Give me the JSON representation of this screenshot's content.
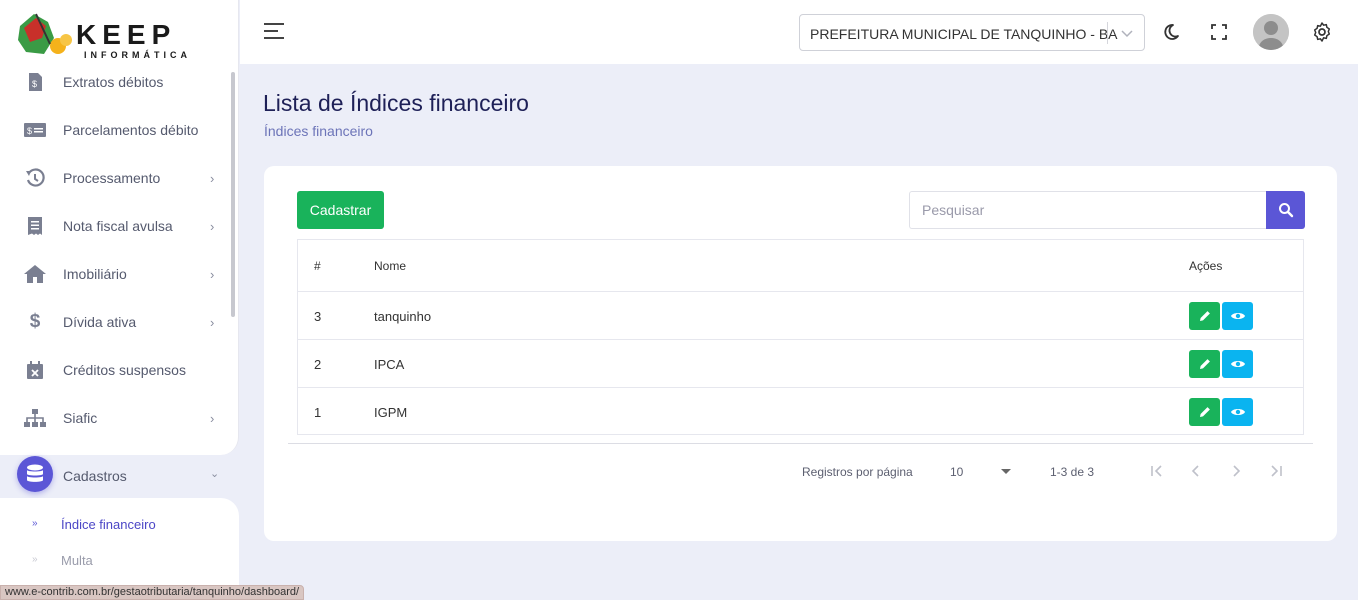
{
  "brand": {
    "name": "KEEP",
    "tagline": "INFORMÁTICA",
    "accent": "#5b56d6"
  },
  "sidebar": {
    "items": [
      {
        "label": "Extratos débitos",
        "icon": "receipt-dollar-icon",
        "has_chevron": false
      },
      {
        "label": "Parcelamentos débito",
        "icon": "money-card-icon",
        "has_chevron": false
      },
      {
        "label": "Processamento",
        "icon": "history-icon",
        "has_chevron": true
      },
      {
        "label": "Nota fiscal avulsa",
        "icon": "invoice-icon",
        "has_chevron": true
      },
      {
        "label": "Imobiliário",
        "icon": "home-icon",
        "has_chevron": true
      },
      {
        "label": "Dívida ativa",
        "icon": "dollar-icon",
        "has_chevron": true
      },
      {
        "label": "Créditos suspensos",
        "icon": "calendar-x-icon",
        "has_chevron": false
      },
      {
        "label": "Siafic",
        "icon": "sitemap-icon",
        "has_chevron": true
      }
    ],
    "cadastros": {
      "label": "Cadastros",
      "icon": "database-icon",
      "expanded": true
    },
    "subitems": [
      {
        "label": "Índice financeiro",
        "active": true
      },
      {
        "label": "Multa",
        "active": false
      }
    ]
  },
  "status_url": "www.e-contrib.com.br/gestaotributaria/tanquinho/dashboard/",
  "header": {
    "organization": "PREFEITURA MUNICIPAL DE TANQUINHO - BA",
    "icons": [
      "menu-icon",
      "moon-icon",
      "fullscreen-icon",
      "avatar",
      "gear-icon"
    ]
  },
  "page": {
    "title": "Lista de Índices financeiro",
    "breadcrumb": "Índices financeiro"
  },
  "toolbar": {
    "cadastrar_label": "Cadastrar",
    "search_placeholder": "Pesquisar",
    "search_value": ""
  },
  "table": {
    "columns": [
      "#",
      "Nome",
      "Ações"
    ],
    "rows": [
      {
        "id": "3",
        "nome": "tanquinho"
      },
      {
        "id": "2",
        "nome": "IPCA"
      },
      {
        "id": "1",
        "nome": "IGPM"
      }
    ]
  },
  "pagination": {
    "rows_per_page_label": "Registros por página",
    "rows_per_page": "10",
    "range": "1-3 de 3"
  },
  "colors": {
    "success": "#19b35b",
    "info": "#0ab4f0",
    "primary": "#5b56d6",
    "title": "#1e2057",
    "background": "#eceef8"
  }
}
